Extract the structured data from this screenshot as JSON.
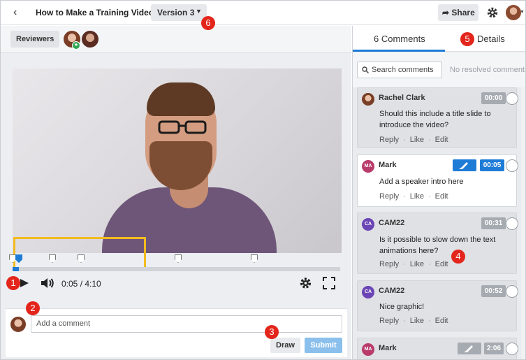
{
  "header": {
    "title": "How to Make a Training Video",
    "version_label": "Version 3",
    "share_label": "Share"
  },
  "reviewers": {
    "label": "Reviewers"
  },
  "player": {
    "current_time": "0:05",
    "total_time": "4:10",
    "time_display": "0:05 / 4:10",
    "progress": 0.02
  },
  "comment_box": {
    "placeholder": "Add a comment",
    "draw_label": "Draw",
    "submit_label": "Submit"
  },
  "sidebar": {
    "tabs": [
      {
        "label": "6 Comments",
        "active": true
      },
      {
        "label": "Details",
        "active": false
      }
    ],
    "search_placeholder": "Search comments",
    "resolved_text": "No resolved comments",
    "comments": [
      {
        "initials": "",
        "author": "Rachel Clark",
        "time": "00:00",
        "text": "Should this include a title slide to introduce the video?",
        "has_drawing": false,
        "highlight": false
      },
      {
        "initials": "MA",
        "author": "Mark",
        "time": "00:05",
        "text": "Add a speaker intro here",
        "has_drawing": true,
        "highlight": true
      },
      {
        "initials": "CA",
        "author": "CAM22",
        "time": "00:31",
        "text": "Is it possible to slow down the text animations here?",
        "has_drawing": false,
        "highlight": false
      },
      {
        "initials": "CA",
        "author": "CAM22",
        "time": "00:52",
        "text": "Nice graphic!",
        "has_drawing": false,
        "highlight": false
      },
      {
        "initials": "MA",
        "author": "Mark",
        "time": "2:06",
        "text": "",
        "has_drawing": true,
        "highlight": false
      }
    ],
    "actions": {
      "reply": "Reply",
      "like": "Like",
      "edit": "Edit"
    }
  },
  "callouts": [
    "1",
    "2",
    "3",
    "4",
    "5",
    "6"
  ],
  "colors": {
    "accent": "#1e7bd6",
    "callout": "#e3251b",
    "annotation": "#f2bb1f"
  }
}
